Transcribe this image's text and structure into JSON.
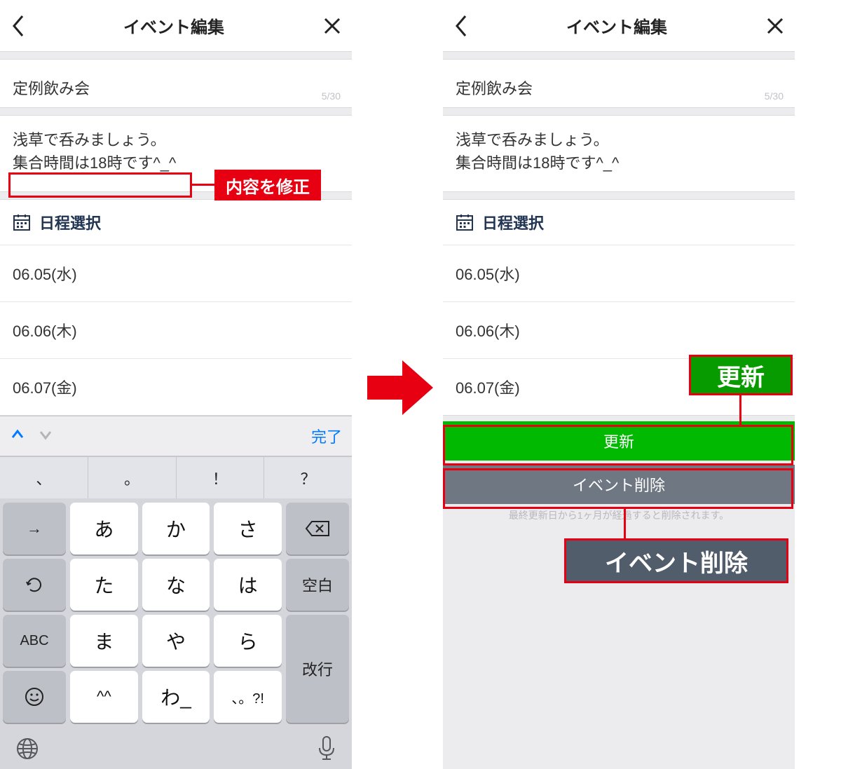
{
  "left": {
    "header": {
      "title": "イベント編集"
    },
    "title": {
      "value": "定例飲み会",
      "counter": "5/30"
    },
    "desc_line1": "浅草で呑みましょう。",
    "desc_line2": "集合時間は18時です^_^",
    "schedule_label": "日程選択",
    "dates": [
      "06.05(水)",
      "06.06(木)",
      "06.07(金)"
    ],
    "accessory": {
      "done": "完了"
    },
    "symbols": [
      "、",
      "。",
      "！",
      "？"
    ],
    "keys": {
      "arrow": "→",
      "row1": [
        "あ",
        "か",
        "さ"
      ],
      "row2": [
        "た",
        "な",
        "は"
      ],
      "space_label": "空白",
      "abc": "ABC",
      "row3": [
        "ま",
        "や",
        "ら"
      ],
      "enter_label": "改行",
      "row4": [
        "^^",
        "わ_",
        "、。?!"
      ]
    }
  },
  "right": {
    "header": {
      "title": "イベント編集"
    },
    "title": {
      "value": "定例飲み会",
      "counter": "5/30"
    },
    "desc_line1": "浅草で呑みましょう。",
    "desc_line2": "集合時間は18時です^_^",
    "schedule_label": "日程選択",
    "dates": [
      "06.05(水)",
      "06.06(木)",
      "06.07(金)"
    ],
    "update_label": "更新",
    "delete_label": "イベント削除",
    "footnote": "最終更新日から1ヶ月が経過すると削除されます。"
  },
  "annotations": {
    "edit_content_label": "内容を修正",
    "update_callout": "更新",
    "delete_callout": "イベント削除"
  }
}
